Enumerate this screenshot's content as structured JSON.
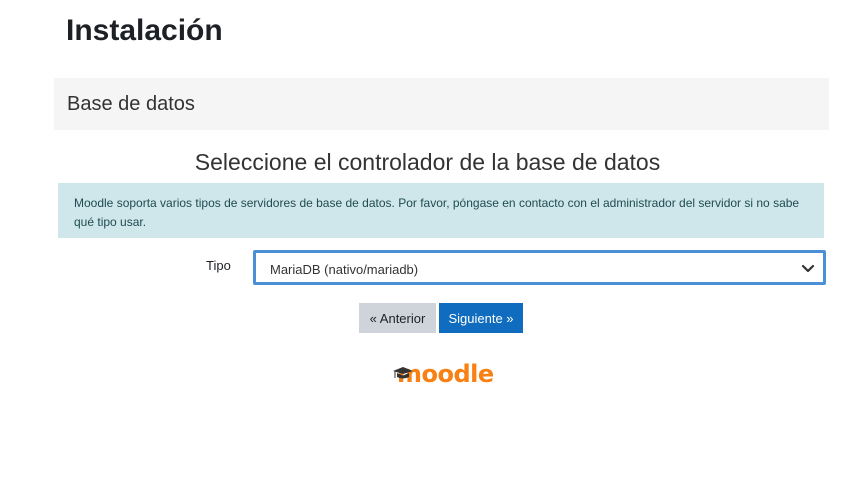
{
  "page": {
    "title": "Instalación"
  },
  "section": {
    "title": "Base de datos"
  },
  "stage": {
    "heading": "Seleccione el controlador de la base de datos",
    "info": "Moodle soporta varios tipos de servidores de base de datos. Por favor, póngase en contacto con el administrador del servidor si no sabe qué tipo usar."
  },
  "form": {
    "type_label": "Tipo",
    "type_selected": "MariaDB (nativo/mariadb)"
  },
  "buttons": {
    "prev_label": "« Anterior",
    "next_label": "Siguiente »"
  },
  "logo": {
    "text": "moodle",
    "icon": "graduation-cap-icon"
  },
  "colors": {
    "info_bg": "#cfe7ea",
    "primary": "#0f6cbf",
    "secondary": "#ced4da",
    "brand_orange": "#f98012",
    "focus_border": "#4b8fd6"
  }
}
